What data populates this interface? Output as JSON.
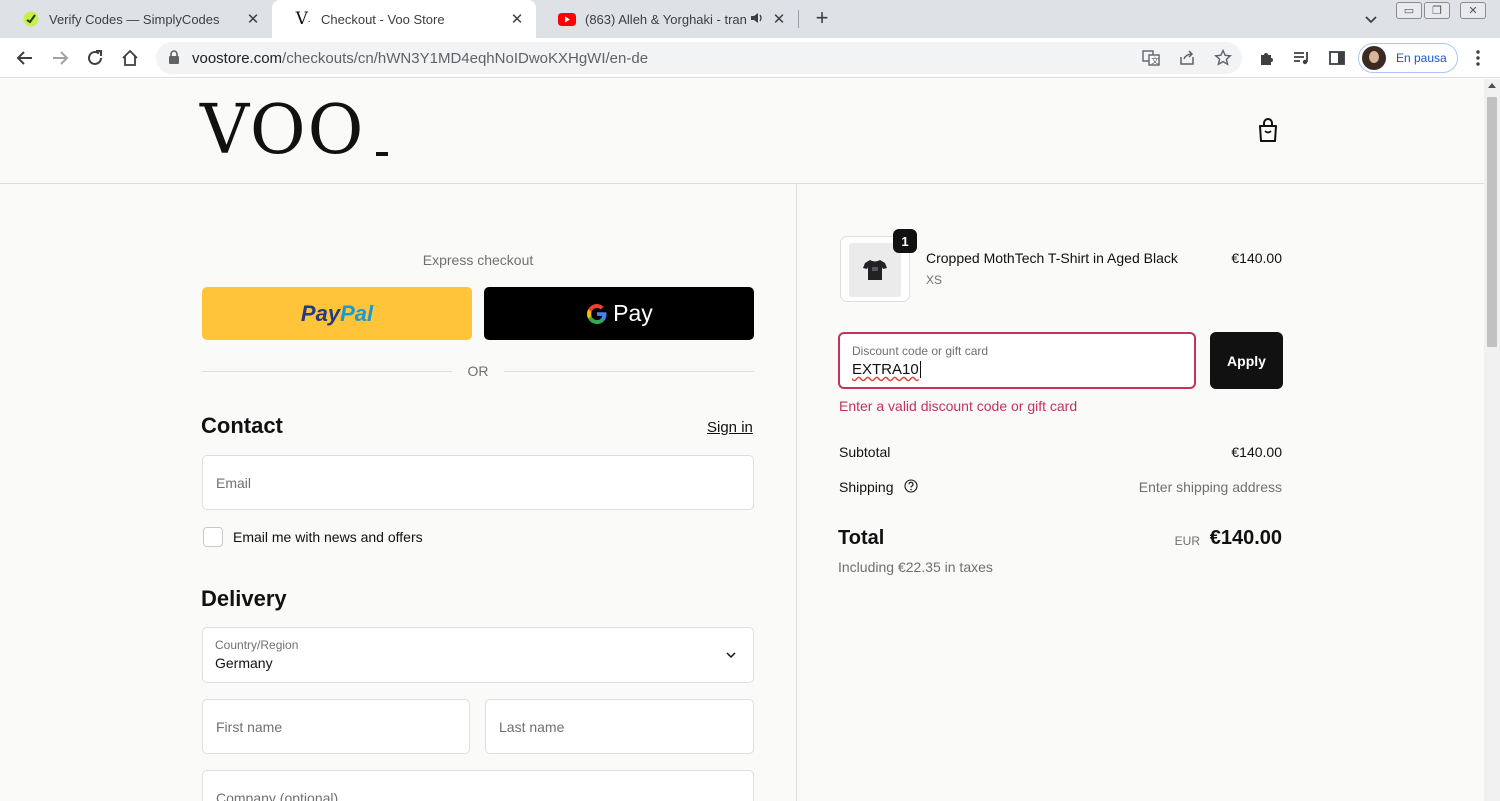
{
  "browser": {
    "tabs": [
      {
        "title": "Verify Codes — SimplyCodes",
        "favicon": "simplycodes-icon",
        "active": false
      },
      {
        "title": "Checkout - Voo Store",
        "favicon": "voo-icon",
        "active": true
      },
      {
        "title": "(863) Alleh & Yorghaki - tran",
        "favicon": "youtube-icon",
        "active": false,
        "audio": true
      }
    ],
    "url_host": "voostore.com",
    "url_path": "/checkouts/cn/hWN3Y1MD4eqhNoIDwoKXHgWI/en-de",
    "profile_label": "En pausa"
  },
  "store": {
    "logo_text": "VOO"
  },
  "checkout": {
    "express_label": "Express checkout",
    "paypal_1": "Pay",
    "paypal_2": "Pal",
    "gpay_label": "Pay",
    "or_label": "OR",
    "contact": {
      "heading": "Contact",
      "signin_label": "Sign in",
      "email_placeholder": "Email",
      "newsletter_label": "Email me with news and offers",
      "newsletter_checked": false
    },
    "delivery": {
      "heading": "Delivery",
      "country_label": "Country/Region",
      "country_value": "Germany",
      "first_name_placeholder": "First name",
      "last_name_placeholder": "Last name",
      "company_placeholder": "Company (optional)"
    }
  },
  "summary": {
    "item": {
      "name": "Cropped MothTech T-Shirt in Aged Black",
      "variant": "XS",
      "price": "€140.00",
      "quantity": "1"
    },
    "discount": {
      "label": "Discount code or gift card",
      "value": "EXTRA10",
      "apply_label": "Apply",
      "error": "Enter a valid discount code or gift card"
    },
    "subtotal_label": "Subtotal",
    "subtotal_value": "€140.00",
    "shipping_label": "Shipping",
    "shipping_value": "Enter shipping address",
    "total_label": "Total",
    "total_currency": "EUR",
    "total_value": "€140.00",
    "taxes_note": "Including €22.35 in taxes"
  },
  "colors": {
    "error": "#c4325f",
    "paypal_bg": "#ffc439",
    "dark": "#111111"
  }
}
